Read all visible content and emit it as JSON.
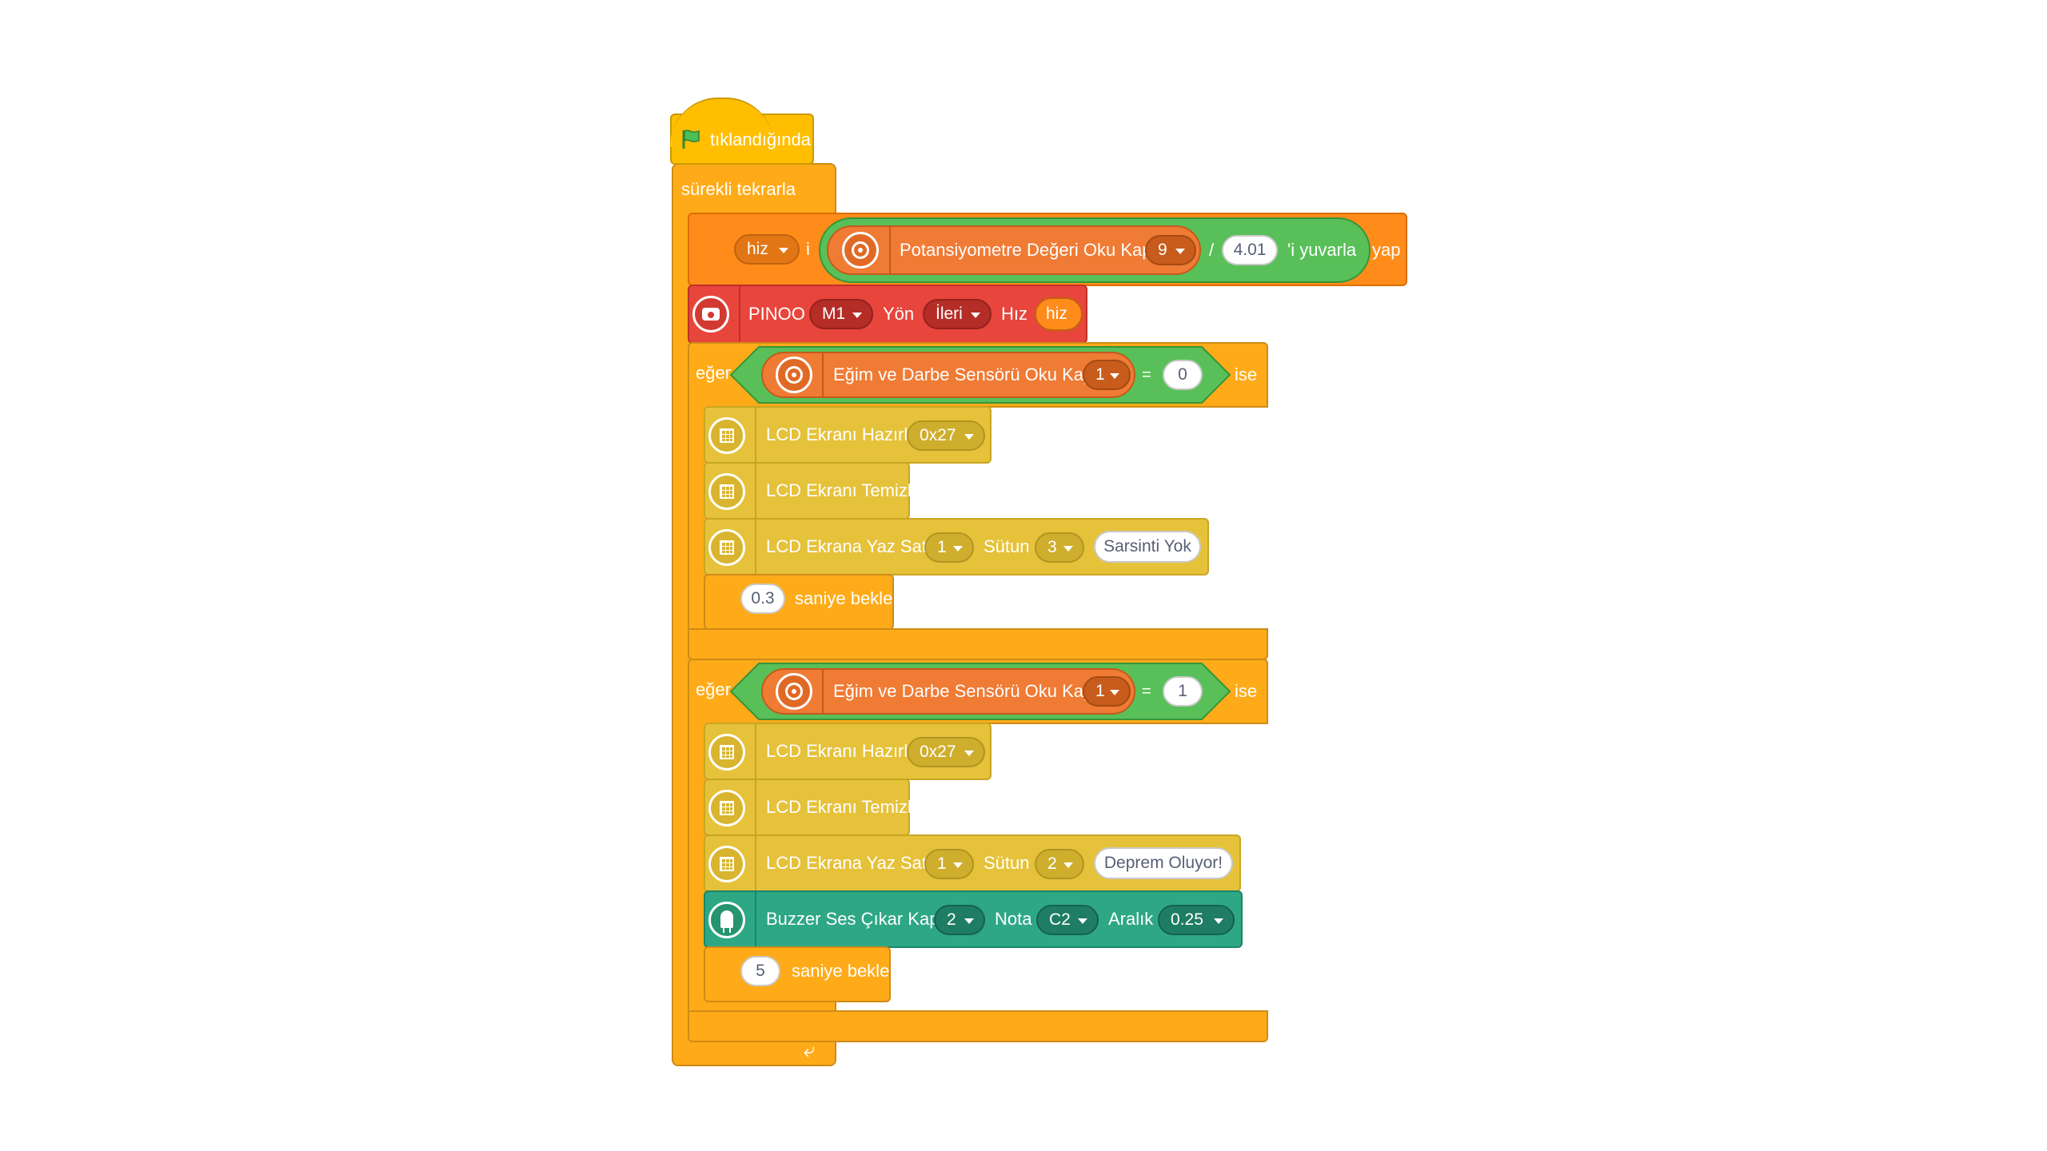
{
  "event": {
    "label": "tıklandığında",
    "icon": "green-flag-icon"
  },
  "forever": {
    "label": "sürekli tekrarla",
    "loop_icon": "loop-arrow-icon"
  },
  "set_var": {
    "var_name": "hiz",
    "connector": "i",
    "round_label": "'i yuvarla",
    "suffix": "yap",
    "sensor_label": "Potansiyometre Değeri Oku Kapı",
    "port": "9",
    "divider": "/",
    "divisor": "4.01"
  },
  "motor": {
    "label": "PINOO",
    "motor": "M1",
    "dir_label": "Yön",
    "dir": "İleri",
    "speed_label": "Hız",
    "speed_var": "hiz"
  },
  "if_blocks": [
    {
      "if_label": "eğer",
      "then_label": "ise",
      "sensor_label": "Eğim ve Darbe Sensörü Oku Kapı",
      "port": "1",
      "op": "=",
      "value": "0",
      "lcd_init": {
        "label": "LCD Ekranı Hazırla",
        "addr": "0x27"
      },
      "lcd_clear": {
        "label": "LCD Ekranı Temizle"
      },
      "lcd_write": {
        "label": "LCD Ekrana Yaz Satır",
        "row": "1",
        "col_label": "Sütun",
        "col": "3",
        "text": "Sarsinti Yok"
      },
      "wait": {
        "value": "0.3",
        "label": "saniye bekle"
      }
    },
    {
      "if_label": "eğer",
      "then_label": "ise",
      "sensor_label": "Eğim ve Darbe Sensörü Oku Kapı",
      "port": "1",
      "op": "=",
      "value": "1",
      "lcd_init": {
        "label": "LCD Ekranı Hazırla",
        "addr": "0x27"
      },
      "lcd_clear": {
        "label": "LCD Ekranı Temizle"
      },
      "lcd_write": {
        "label": "LCD Ekrana Yaz Satır",
        "row": "1",
        "col_label": "Sütun",
        "col": "2",
        "text": "Deprem Oluyor!"
      },
      "buzzer": {
        "label": "Buzzer Ses Çıkar Kapı",
        "port": "2",
        "note_label": "Nota",
        "note": "C2",
        "range_label": "Aralık",
        "range": "0.25"
      },
      "wait": {
        "value": "5",
        "label": "saniye bekle"
      }
    }
  ],
  "colors": {
    "control": "#FFAB19",
    "event": "#FFBF00",
    "variable": "#FF8C1A",
    "operator": "#59C059",
    "sensor": "#EF7B35",
    "lcd": "#E6C23A",
    "motor": "#E8453C",
    "buzzer": "#2EA785"
  }
}
